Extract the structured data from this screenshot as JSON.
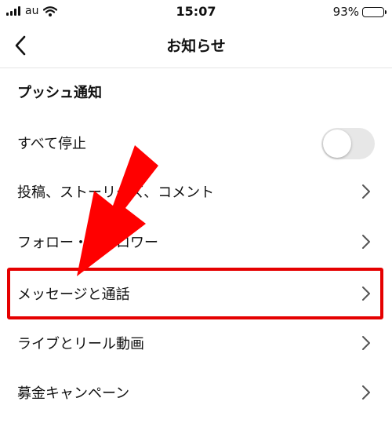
{
  "status_bar": {
    "carrier": "au",
    "time": "15:07",
    "battery": "93%",
    "battery_level": 0.93
  },
  "nav": {
    "title": "お知らせ",
    "back_icon": "chevron-left-icon"
  },
  "section": {
    "title": "プッシュ通知"
  },
  "rows": [
    {
      "label": "すべて停止",
      "control": "toggle",
      "toggle_on": false
    },
    {
      "label": "投稿、ストーリーズ、コメント",
      "control": "chevron"
    },
    {
      "label": "フォロー・フォロワー",
      "control": "chevron"
    },
    {
      "label": "メッセージと通話",
      "control": "chevron",
      "highlighted": true
    },
    {
      "label": "ライブとリール動画",
      "control": "chevron"
    },
    {
      "label": "募金キャンペーン",
      "control": "chevron"
    }
  ],
  "annotation": {
    "arrow_color": "#ff0000",
    "highlight_color": "#e50000"
  }
}
